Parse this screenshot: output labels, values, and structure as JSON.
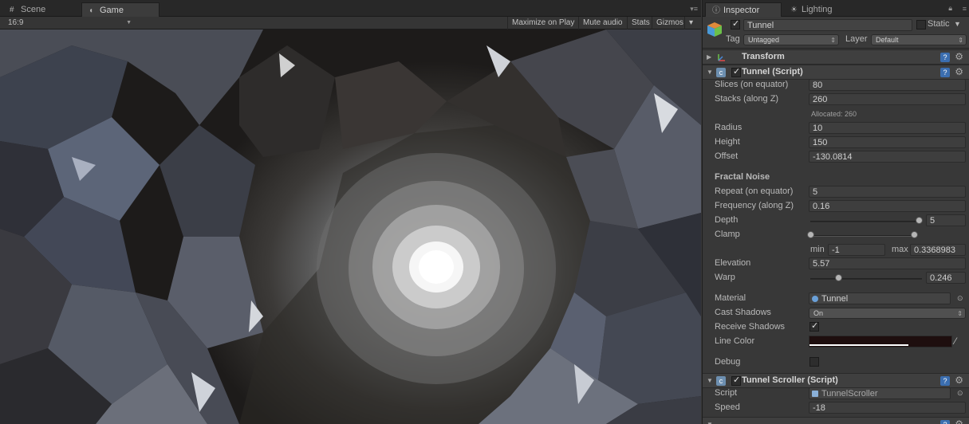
{
  "left_tabs": [
    {
      "label": "Scene",
      "icon": "scene-grid-icon"
    },
    {
      "label": "Game",
      "icon": "pacman-icon"
    }
  ],
  "game_toolbar": {
    "aspect": "16:9",
    "maximize_on_play": "Maximize on Play",
    "mute_audio": "Mute audio",
    "stats": "Stats",
    "gizmos": "Gizmos"
  },
  "right_tabs": [
    {
      "label": "Inspector",
      "icon": "info-icon"
    },
    {
      "label": "Lighting",
      "icon": "lighting-icon"
    }
  ],
  "object": {
    "name": "Tunnel",
    "active": true,
    "static_label": "Static",
    "static": false,
    "tag_label": "Tag",
    "tag_value": "Untagged",
    "layer_label": "Layer",
    "layer_value": "Default"
  },
  "transform": {
    "title": "Transform"
  },
  "tunnel_script": {
    "title": "Tunnel (Script)",
    "slices_label": "Slices (on equator)",
    "slices": "80",
    "stacks_label": "Stacks (along Z)",
    "stacks": "260",
    "allocated": "Allocated: 260",
    "radius_label": "Radius",
    "radius": "10",
    "height_label": "Height",
    "height": "150",
    "offset_label": "Offset",
    "offset": "-130.0814",
    "fractal_header": "Fractal Noise",
    "repeat_label": "Repeat (on equator)",
    "repeat": "5",
    "frequency_label": "Frequency (along Z)",
    "frequency": "0.16",
    "depth_label": "Depth",
    "depth": "5",
    "depth_slider_fraction": 0.97,
    "clamp_label": "Clamp",
    "min_label": "min",
    "min": "-1",
    "max_label": "max",
    "max": "0.3368983",
    "elevation_label": "Elevation",
    "elevation": "5.57",
    "warp_label": "Warp",
    "warp": "0.246",
    "warp_slider_fraction": 0.25,
    "material_label": "Material",
    "material": "Tunnel",
    "cast_shadows_label": "Cast Shadows",
    "cast_shadows": "On",
    "receive_shadows_label": "Receive Shadows",
    "receive_shadows": true,
    "line_color_label": "Line Color",
    "line_color": "#1e0e0e",
    "debug_label": "Debug",
    "debug": false
  },
  "tunnel_scroller": {
    "title": "Tunnel Scroller (Script)",
    "script_label": "Script",
    "script": "TunnelScroller",
    "speed_label": "Speed",
    "speed": "-18"
  },
  "colors": {
    "accent_help": "#3b6eb0",
    "panel_bg": "#383838"
  }
}
